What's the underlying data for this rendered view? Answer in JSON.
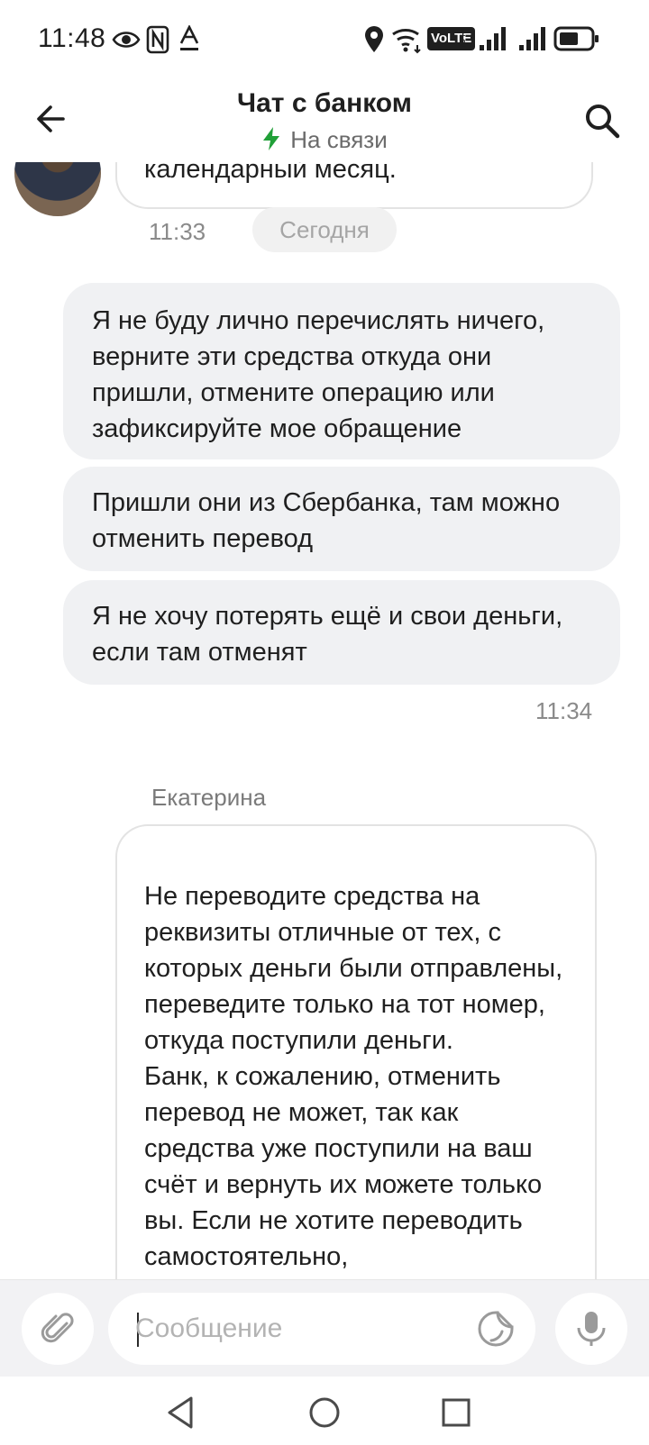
{
  "status_bar": {
    "time": "11:48",
    "network_label": "VoLTE",
    "sim_labels": "1 2"
  },
  "header": {
    "title": "Чат с банком",
    "status": "На связи",
    "status_color": "#21a038"
  },
  "chat": {
    "previous_message_tail": "календарный месяц.",
    "previous_time": "11:33",
    "date_divider": "Сегодня",
    "outgoing": [
      {
        "text": "Я не буду лично перечислять ничего, верните эти средства откуда они пришли, отмените операцию или зафиксируйте мое обращение"
      },
      {
        "text": "Пришли они из Сбербанка, там можно отменить перевод"
      },
      {
        "text": "Я не хочу потерять ещё и свои деньги, если там отменят"
      }
    ],
    "outgoing_time": "11:34",
    "operator_name": "Екатерина",
    "operator_message": "Не переводите средства на реквизиты отличные от тех, с которых деньги были отправлены, переведите только на тот номер, откуда поступили деньги.\nБанк, к сожалению, отменить перевод не может, так как средства уже поступили на ваш счёт и вернуть их можете только вы. Если не хотите переводить самостоятельно,"
  },
  "composer": {
    "placeholder": "Сообщение"
  },
  "icons": {
    "back": "arrow-left-icon",
    "search": "search-icon",
    "attach": "paperclip-icon",
    "sticker": "sticker-icon",
    "mic": "microphone-icon"
  }
}
